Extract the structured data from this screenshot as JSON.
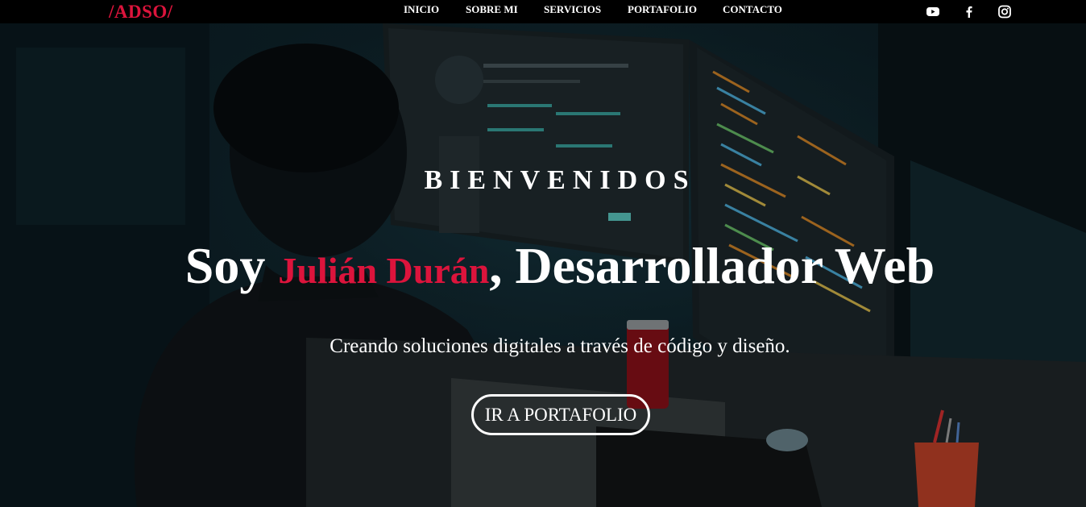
{
  "brand": {
    "logo": "/ADSO/",
    "accent_color": "#dc143c"
  },
  "nav": {
    "items": [
      {
        "label": "INICIO"
      },
      {
        "label": "SOBRE MI"
      },
      {
        "label": "SERVICIOS"
      },
      {
        "label": "PORTAFOLIO"
      },
      {
        "label": "CONTACTO"
      }
    ]
  },
  "social": [
    {
      "icon": "youtube-icon"
    },
    {
      "icon": "facebook-icon"
    },
    {
      "icon": "instagram-icon"
    }
  ],
  "hero": {
    "welcome": "BIENVENIDOS",
    "headline_prefix": "Soy ",
    "headline_name": "Julián Durán",
    "headline_suffix": ", Desarrollador Web",
    "tagline": "Creando soluciones digitales a través de código y diseño.",
    "cta_label": "IR A PORTAFOLIO"
  }
}
